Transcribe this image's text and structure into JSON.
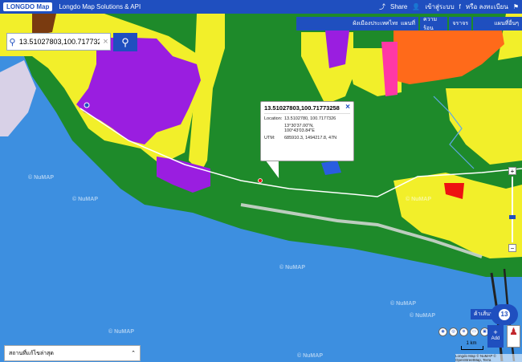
{
  "header": {
    "logo": "LONGDO Map",
    "title": "Longdo Map Solutions & API",
    "share": "Share",
    "login": "เข้าสู่ระบบ",
    "register": "หรือ ลงทะเบียน"
  },
  "layers": {
    "cityplan": "ผังเมืองประเทศไทย",
    "map": "แผนที่",
    "zoning": "ความร้อน",
    "traffic": "จราจร",
    "more": "แผนที่อื่นๆ"
  },
  "search": {
    "value": "13.51027803,100.71773258"
  },
  "popup": {
    "title": "13.51027803,100.71773258",
    "location_label": "Location:",
    "location_value": "13.5102780, 100.7177326",
    "dms_lat": "13°30'37.00\"N,",
    "dms_lon": "100°43'03.84\"E",
    "utm_label": "UTM:",
    "utm_value": "685910.3, 1494217.8, 47N"
  },
  "controls": {
    "route": "ค้าเส้นทาง",
    "add": "Add",
    "scale": "1 km",
    "nav_center": "13"
  },
  "bottom_panel": {
    "label": "สถานที่แก้ไขล่าสุด"
  },
  "attribution": "Longdo Map © NuMAP © OpenStreetMap, Terra",
  "watermarks": [
    "© NuMAP",
    "© NuMAP",
    "© NuMAP",
    "© NuMAP",
    "© NuMAP",
    "© NuMAP",
    "© NuMAP",
    "© NuMAP"
  ],
  "colors": {
    "brand": "#1f4fbf",
    "sea": "#3d8fe0",
    "green_zone": "#1e8a2a",
    "yellow_zone": "#f2ef2a",
    "purple_zone": "#9a1ee0",
    "orange_zone": "#ff6a1a",
    "pink_zone": "#ff38a6"
  }
}
